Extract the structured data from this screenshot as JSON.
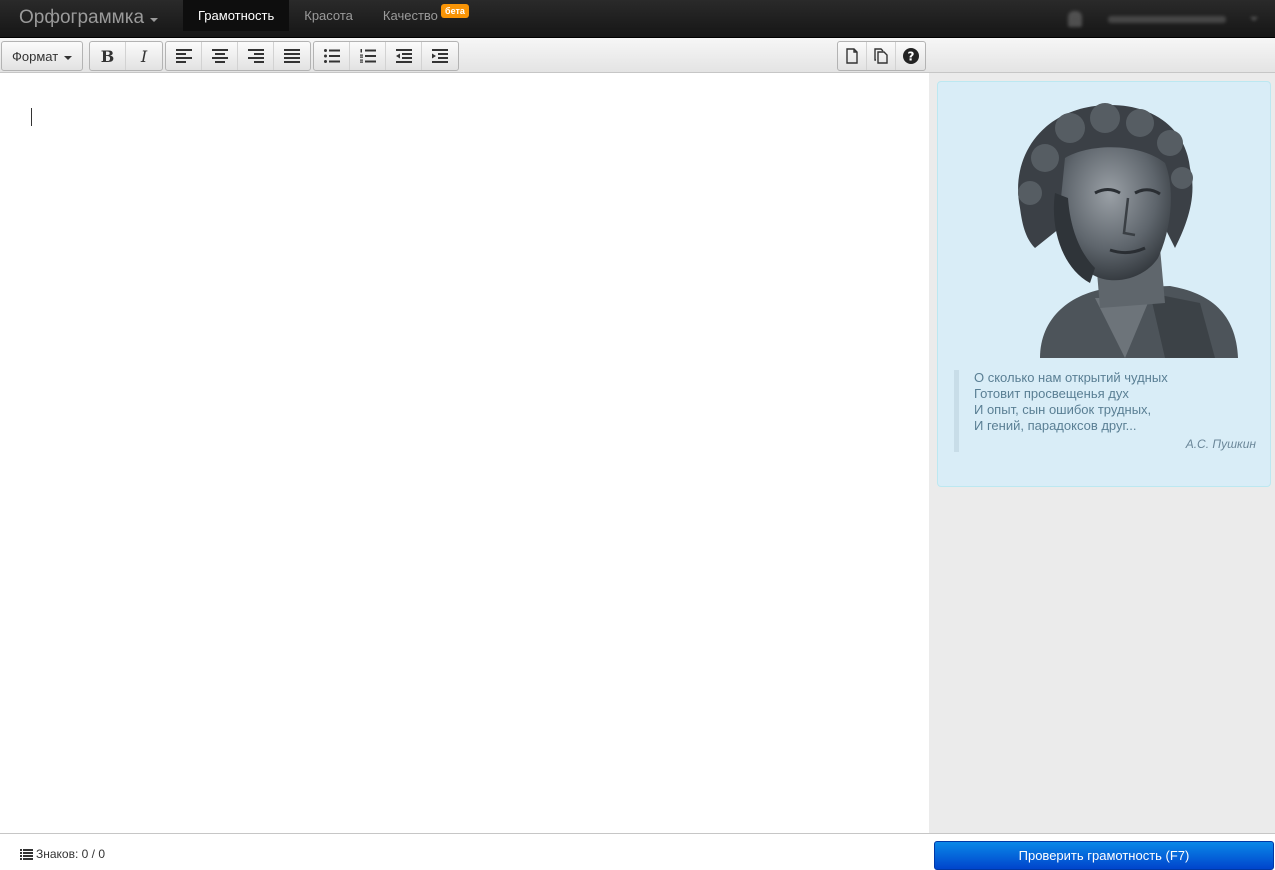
{
  "navbar": {
    "brand": "Орфограммка",
    "tabs": [
      {
        "label": "Грамотность",
        "active": true
      },
      {
        "label": "Красота",
        "active": false
      },
      {
        "label": "Качество",
        "active": false,
        "badge": "бета"
      }
    ]
  },
  "toolbar": {
    "format_label": "Формат",
    "bold_label": "B",
    "italic_label": "I",
    "icons": [
      "align-left-icon",
      "align-center-icon",
      "align-right-icon",
      "align-justify-icon",
      "bullet-list-icon",
      "numbered-list-icon",
      "outdent-icon",
      "indent-icon",
      "new-document-icon",
      "copy-icon",
      "help-icon"
    ]
  },
  "quote": {
    "lines": [
      "О сколько нам открытий чудных",
      "Готовит просвещенья дух",
      "И опыт, сын ошибок трудных,",
      "И гений, парадоксов друг..."
    ],
    "author": "А.С. Пушкин"
  },
  "status": {
    "counter": "Знаков: 0 / 0"
  },
  "check_button": "Проверить грамотность (F7)",
  "colors": {
    "navbar": "#1b1b1b",
    "accent_badge": "#f89406",
    "primary_button": "#0055d8",
    "quote_card": "#d9edf7"
  }
}
